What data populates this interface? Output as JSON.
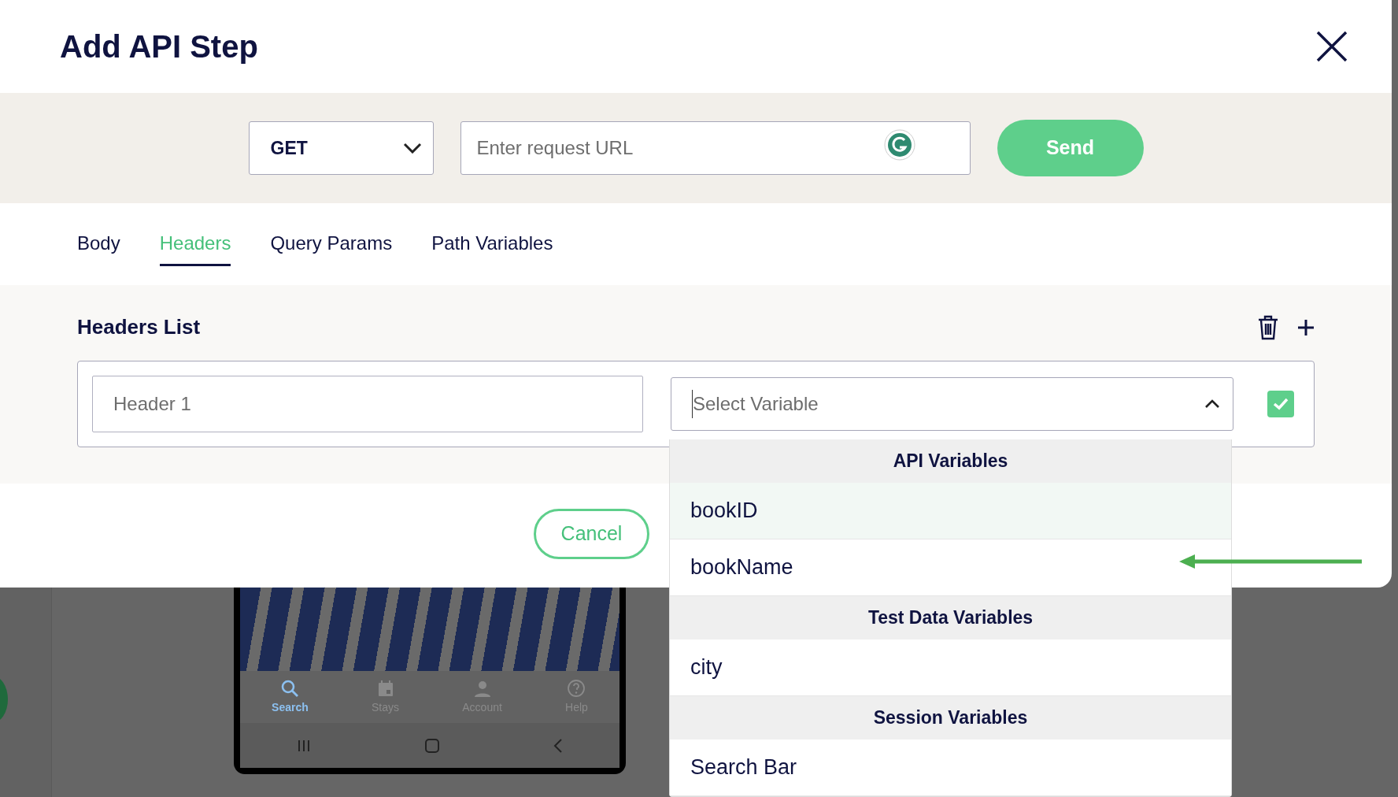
{
  "dialog": {
    "title": "Add API Step"
  },
  "request": {
    "method": "GET",
    "url_placeholder": "Enter request URL",
    "send": "Send"
  },
  "tabs": [
    {
      "label": "Body",
      "selected": false
    },
    {
      "label": "Headers",
      "selected": true
    },
    {
      "label": "Query Params",
      "selected": false
    },
    {
      "label": "Path Variables",
      "selected": false
    }
  ],
  "headers": {
    "title": "Headers List",
    "rows": [
      {
        "name_placeholder": "Header 1",
        "value_placeholder": "Select Variable",
        "expanded": true,
        "checked": true
      }
    ]
  },
  "variable_menu": {
    "groups": [
      {
        "title": "API Variables",
        "items": [
          {
            "label": "bookID",
            "selected": true
          },
          {
            "label": "bookName",
            "selected": false
          }
        ]
      },
      {
        "title": "Test Data Variables",
        "items": [
          {
            "label": "city",
            "selected": false
          }
        ]
      },
      {
        "title": "Session Variables",
        "items": [
          {
            "label": "Search Bar",
            "selected": false
          }
        ]
      }
    ]
  },
  "footer": {
    "cancel": "Cancel"
  },
  "background_app": {
    "nav": [
      {
        "label": "Search",
        "kind": "search",
        "selected": true
      },
      {
        "label": "Stays",
        "kind": "calendar",
        "selected": false
      },
      {
        "label": "Account",
        "kind": "person",
        "selected": false
      },
      {
        "label": "Help",
        "kind": "help",
        "selected": false
      }
    ]
  }
}
